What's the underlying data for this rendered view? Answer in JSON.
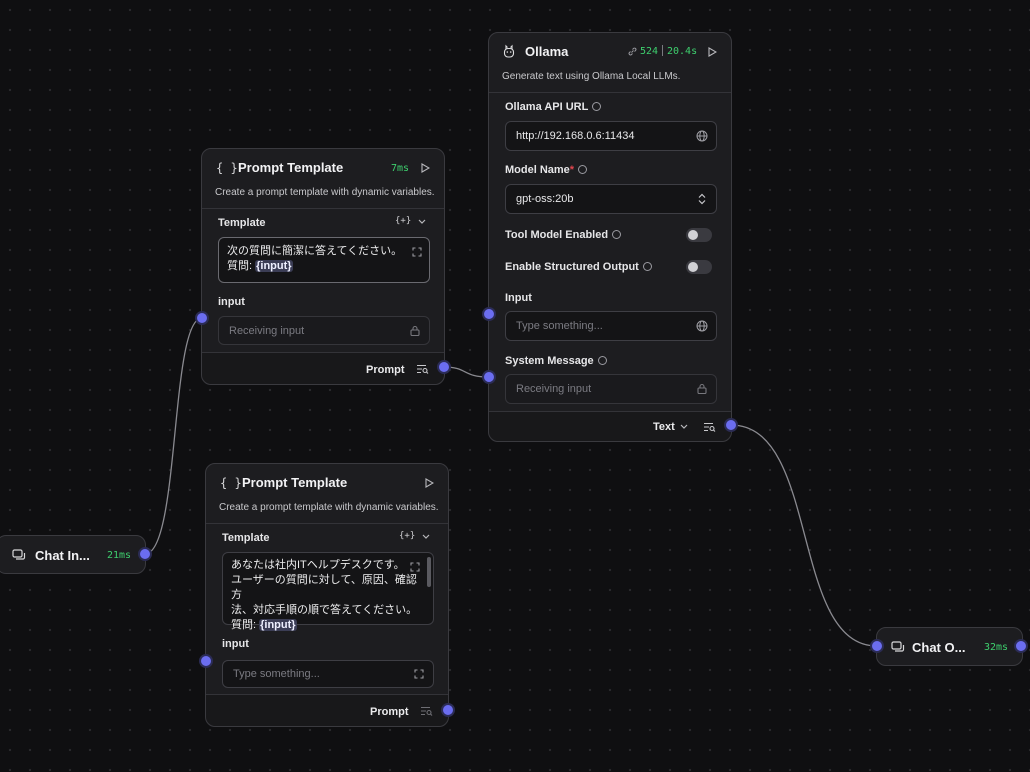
{
  "nodes": {
    "chat_input": {
      "title": "Chat In...",
      "timing": "21ms"
    },
    "prompt1": {
      "title": "Prompt Template",
      "timing": "7ms",
      "description": "Create a prompt template with dynamic variables.",
      "template_label": "Template",
      "template_line1": "次の質問に簡潔に答えてください。",
      "template_line2_prefix": "質問: ",
      "template_var": "{input}",
      "input_label": "input",
      "input_placeholder": "Receiving input",
      "output_label": "Prompt"
    },
    "prompt2": {
      "title": "Prompt Template",
      "description": "Create a prompt template with dynamic variables.",
      "template_label": "Template",
      "template_line1": "あなたは社内ITヘルプデスクです。",
      "template_line2": "ユーザーの質問に対して、原因、確認方",
      "template_line3": "法、対応手順の順で答えてください。",
      "template_line4_prefix": "質問: ",
      "template_var": "{input}",
      "input_label": "input",
      "input_placeholder": "Type something...",
      "output_label": "Prompt"
    },
    "ollama": {
      "title": "Ollama",
      "tokens": "524",
      "duration": "20.4s",
      "description": "Generate text using Ollama Local LLMs.",
      "api_url_label": "Ollama API URL",
      "api_url_value": "http://192.168.0.6:11434",
      "model_label": "Model Name",
      "model_value": "gpt-oss:20b",
      "tool_model_label": "Tool Model Enabled",
      "tool_model_enabled": false,
      "structured_label": "Enable Structured Output",
      "structured_enabled": false,
      "input_label": "Input",
      "input_placeholder": "Type something...",
      "system_label": "System Message",
      "system_placeholder": "Receiving input",
      "output_label": "Text"
    },
    "chat_output": {
      "title": "Chat O...",
      "timing": "32ms"
    }
  },
  "colors": {
    "handle": "#6b6df0",
    "timing": "#3ecf6e",
    "required": "#e0464e",
    "edge": "#8a8a90"
  },
  "icons": [
    "braces-icon",
    "play-icon",
    "expand-icon",
    "lock-icon",
    "globe-icon",
    "chevron-updown-icon",
    "chat-icon",
    "link-icon",
    "ollama-icon",
    "variable-icon",
    "inspect-icon"
  ]
}
